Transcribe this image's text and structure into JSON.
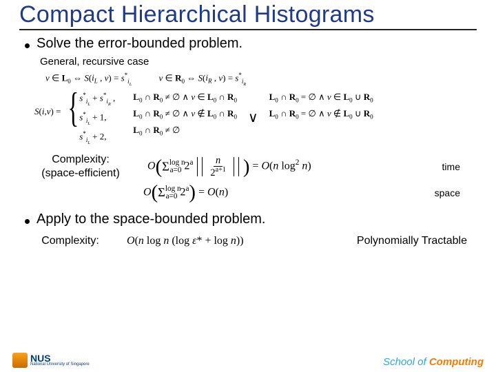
{
  "title": "Compact Hierarchical Histograms",
  "bullet1": "Solve the error-bounded problem.",
  "subheading": "General, recursive case",
  "math": {
    "bicond_left": "v ∈ L₀ ⇔ S(i_L , v) = s*_{i_L}",
    "bicond_right": "v ∈ R₀ ⇔ S(i_R , v) = s*_{i_R}",
    "lhs": "S(i, v) =",
    "case1": "s*_{i_L} + s*_{i_R} ,",
    "case2": "s*_{i_L} + 1,",
    "case3": "s*_{i_L} + 2,",
    "cond1a": "L₀ ∩ R₀ ≠ ∅ ∧ v ∈ L₀ ∩ R₀",
    "cond2a": "L₀ ∩ R₀ ≠ ∅ ∧ v ∉ L₀ ∩ R₀",
    "cond3a": "L₀ ∩ R₀ ≠ ∅",
    "vee": "∨",
    "cond1b": "L₀ ∩ R₀ = ∅ ∧ v ∈ L₀ ∪ R₀",
    "cond2b": "L₀ ∩ R₀ = ∅ ∧ v ∉ L₀ ∪ R₀"
  },
  "complexity": {
    "label1": "Complexity:",
    "label2": "(space-efficient)",
    "time_formula_prefix": "O",
    "time_sum_sub": "a=0",
    "time_sum_sup": "log n",
    "time_term1": "2ᵃ",
    "time_frac_num": "n",
    "time_frac_den": "2ᵃ⁺¹",
    "time_rhs": "= O(n log² n)",
    "time_tag": "time",
    "space_formula": "O(Σ 2ᵃ) = O(n)",
    "space_sum_sub": "a=0",
    "space_sum_sup": "log n",
    "space_term": "2ᵃ",
    "space_rhs": "= O(n)",
    "space_tag": "space"
  },
  "bullet2": "Apply to the space-bounded problem.",
  "complexity2": {
    "label": "Complexity:",
    "formula": "O(n log n (log ε* + log n))",
    "desc": "Polynomially Tractable"
  },
  "footer": {
    "nus": "NUS",
    "nus_sub": "National University of Singapore",
    "school": "School",
    "of": " of ",
    "computing": "Computing"
  }
}
